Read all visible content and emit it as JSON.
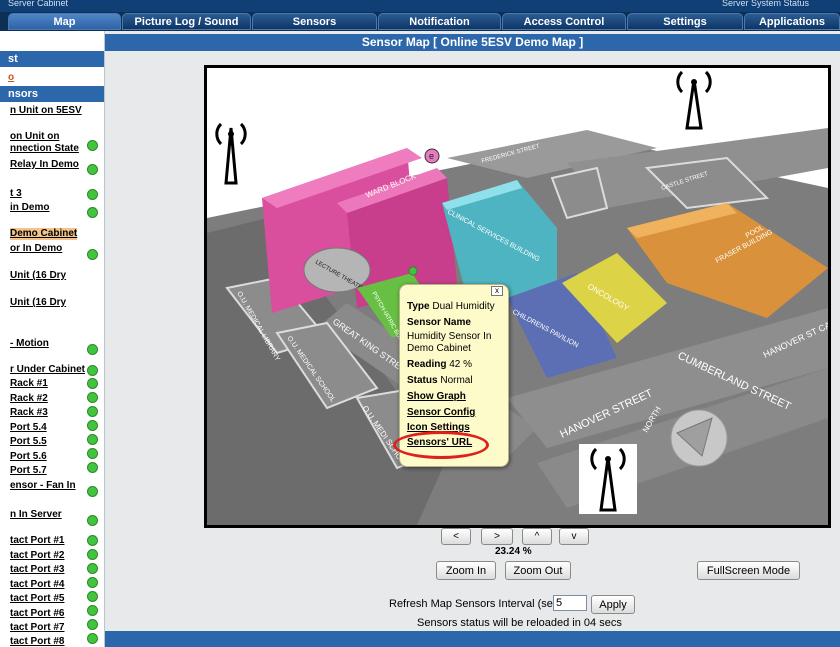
{
  "top_strip": {
    "left_text": "Server Cabinet",
    "right_text": "Server System Status"
  },
  "tabs": [
    {
      "label": "Map",
      "active": true
    },
    {
      "label": "Picture Log / Sound Log"
    },
    {
      "label": "Sensors"
    },
    {
      "label": "Notification"
    },
    {
      "label": "Access Control"
    },
    {
      "label": "Settings"
    },
    {
      "label": "Applications"
    }
  ],
  "sidebar": {
    "head_list": "st",
    "orange_link": "o",
    "head_sensors": "nsors",
    "items": [
      {
        "label": "n Unit on 5ESV",
        "dot": false
      },
      {
        "label": "on Unit on",
        "dot": false
      },
      {
        "label": "nnection State",
        "dot": true
      },
      {
        "label": "Relay In Demo",
        "dot": true
      },
      {
        "label": "t 3",
        "dot": true
      },
      {
        "label": "in Demo",
        "dot": true
      },
      {
        "label": "Demo Cabinet",
        "dot": false,
        "highlight": true
      },
      {
        "label": "or In Demo",
        "dot": true
      },
      {
        "label": "Unit (16 Dry",
        "dot": false
      },
      {
        "label": "Unit (16 Dry",
        "dot": false
      },
      {
        "label": "- Motion",
        "dot": true
      },
      {
        "label": "r Under Cabinet",
        "dot": true
      },
      {
        "label": "Rack #1",
        "dot": true
      },
      {
        "label": "Rack #2",
        "dot": true
      },
      {
        "label": "Rack #3",
        "dot": true
      },
      {
        "label": "Port 5.4",
        "dot": true
      },
      {
        "label": "Port 5.5",
        "dot": true
      },
      {
        "label": "Port 5.6",
        "dot": true
      },
      {
        "label": "Port 5.7",
        "dot": true
      },
      {
        "label": "ensor - Fan In",
        "dot": true
      },
      {
        "label": "n In Server",
        "dot": true
      },
      {
        "label": "tact Port #1",
        "dot": true
      },
      {
        "label": "tact Port #2",
        "dot": true
      },
      {
        "label": "tact Port #3",
        "dot": true
      },
      {
        "label": "tact Port #4",
        "dot": true
      },
      {
        "label": "tact Port #5",
        "dot": true
      },
      {
        "label": "tact Port #6",
        "dot": true
      },
      {
        "label": "tact Port #7",
        "dot": true
      },
      {
        "label": "tact Port #8",
        "dot": true
      }
    ]
  },
  "map": {
    "title": "Sensor Map [ Online 5ESV Demo Map ]",
    "streets": {
      "frederick": "FREDERICK STREET",
      "castle": "CASTLE STREET",
      "great_king": "GREAT KING STREET",
      "cumberland": "CUMBERLAND STREET",
      "hanover": "HANOVER STREET",
      "hanover_car": "HANOVER ST CAR PA",
      "north": "NORTH"
    },
    "buildings": {
      "ward_block": "WARD BLOCK",
      "clinical": "CLINICAL SERVICES BUILDING",
      "lecture": "LECTURE THEATRES",
      "psych": "PSYCH-IATRIC BUILDING",
      "childrens": "CHILDRENS PAVILION",
      "oncology": "ONCOLOGY",
      "fraser": "FRASER BUILDING",
      "pool": "POOL",
      "ou_library": "O.U. MEDICAL LIBRARY",
      "ou_school": "O.U. MEDICAL SCHOOL",
      "ou_school2": "O.U. MEDI SCHOO",
      "dunedin": "DUNEDIN HOSP.",
      "emergency": "EMERGENCY",
      "sensor_letter": "e"
    }
  },
  "popup": {
    "type_label": "Type",
    "type_value": "Dual Humidity",
    "name_label": "Sensor Name",
    "name_value": "Humidity Sensor In Demo Cabinet",
    "reading_label": "Reading",
    "reading_value": "42 %",
    "status_label": "Status",
    "status_value": "Normal",
    "show_graph": "Show Graph",
    "sensor_config": "Sensor Config",
    "icon_settings": "Icon Settings",
    "sensors_url": "Sensors' URL",
    "close": "x"
  },
  "controls": {
    "left": "<",
    "right": ">",
    "up": "^",
    "down": "v",
    "zoom_level": "23.24 %",
    "zoom_in": "Zoom In",
    "zoom_out": "Zoom Out",
    "fullscreen": "FullScreen Mode",
    "refresh_label": "Refresh Map Sensors Interval (sec.)",
    "refresh_value": "5",
    "apply": "Apply",
    "status_text": "Sensors status will be reloaded in 04 secs"
  },
  "colors": {
    "tab_active": "#3f79bd",
    "panel_head": "#2d67ab",
    "sensor_ok": "#43c43f",
    "popup_bg": "#fdfbc9",
    "highlight_ring": "#e0201c"
  }
}
